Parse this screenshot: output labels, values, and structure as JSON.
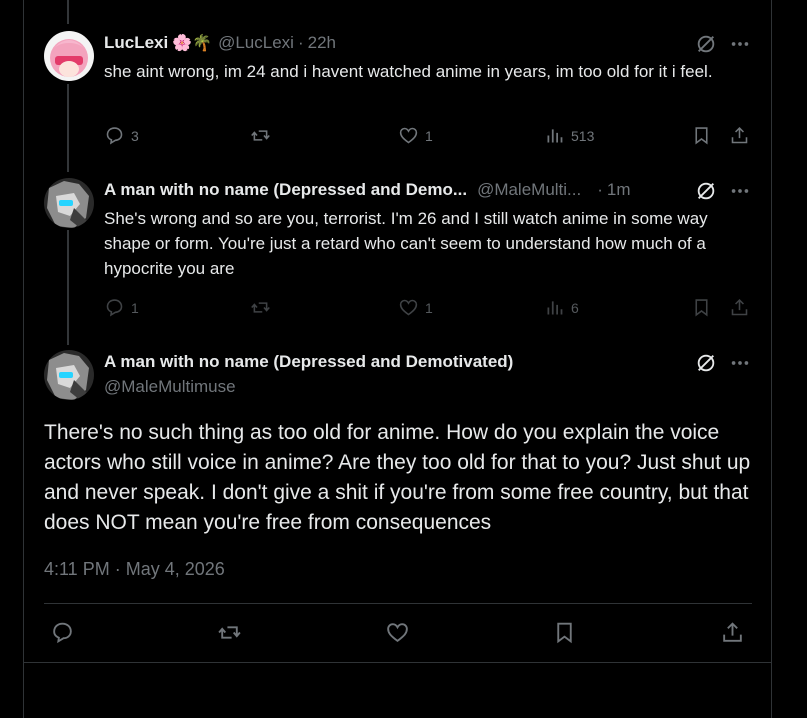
{
  "reply1": {
    "name": "LucLexi",
    "emojis": "🌸🌴",
    "handle": "@LucLexi",
    "sep": "·",
    "time": "22h",
    "text": "she aint wrong, im 24 and i havent watched anime in years, im too old for it i feel.",
    "replies": "3",
    "likes": "1",
    "views": "513"
  },
  "reply2": {
    "name": "A man with no name (Depressed and Demo...",
    "handle": "@MaleMulti...",
    "sep": "·",
    "time": "1m",
    "text": "She's wrong and so are you, terrorist. I'm 26 and I still watch anime in some way shape or form. You're just a retard who can't seem to understand how much of a hypocrite you are",
    "replies": "1",
    "likes": "1",
    "views": "6"
  },
  "main": {
    "name": "A man with no name (Depressed and Demotivated)",
    "handle": "@MaleMultimuse",
    "text": "There's no such thing as too old for anime. How do you explain the voice actors who still voice in anime? Are they too old for that to you? Just shut up and never speak. I don't give a shit if you're from some free country, but that does NOT mean you're free from consequences",
    "timestamp": "4:11 PM · May 4, 2026"
  },
  "icons": {
    "reply": "reply-icon",
    "retweet": "retweet-icon",
    "like": "like-icon",
    "views": "views-icon",
    "bookmark": "bookmark-icon",
    "share": "share-icon",
    "grok": "grok-icon",
    "more": "more-icon"
  },
  "colors": {
    "background": "#000000",
    "text": "#e7e9ea",
    "muted": "#71767b",
    "border": "#2f3336"
  }
}
